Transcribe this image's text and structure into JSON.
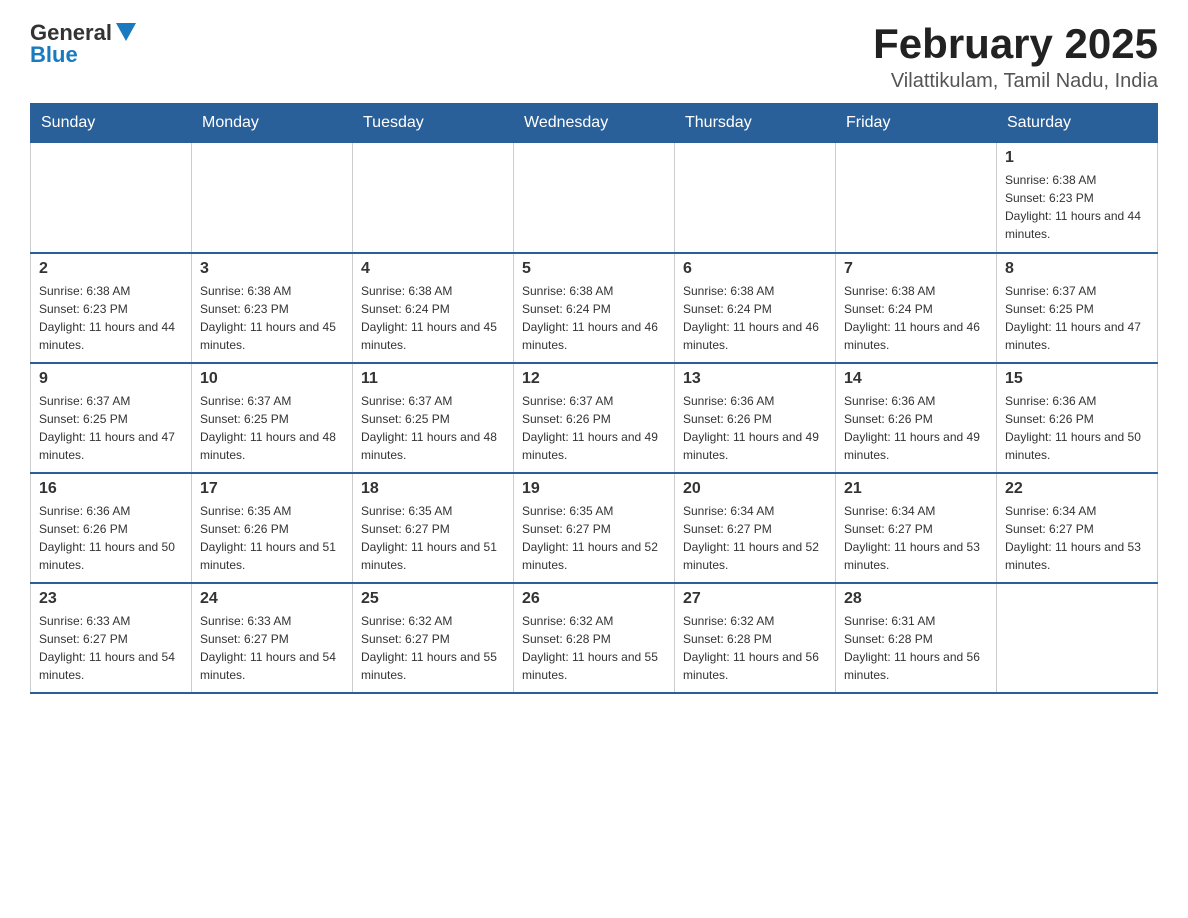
{
  "logo": {
    "text_general": "General",
    "text_blue": "Blue"
  },
  "title": "February 2025",
  "subtitle": "Vilattikulam, Tamil Nadu, India",
  "days_of_week": [
    "Sunday",
    "Monday",
    "Tuesday",
    "Wednesday",
    "Thursday",
    "Friday",
    "Saturday"
  ],
  "weeks": [
    [
      {
        "day": "",
        "info": ""
      },
      {
        "day": "",
        "info": ""
      },
      {
        "day": "",
        "info": ""
      },
      {
        "day": "",
        "info": ""
      },
      {
        "day": "",
        "info": ""
      },
      {
        "day": "",
        "info": ""
      },
      {
        "day": "1",
        "info": "Sunrise: 6:38 AM\nSunset: 6:23 PM\nDaylight: 11 hours and 44 minutes."
      }
    ],
    [
      {
        "day": "2",
        "info": "Sunrise: 6:38 AM\nSunset: 6:23 PM\nDaylight: 11 hours and 44 minutes."
      },
      {
        "day": "3",
        "info": "Sunrise: 6:38 AM\nSunset: 6:23 PM\nDaylight: 11 hours and 45 minutes."
      },
      {
        "day": "4",
        "info": "Sunrise: 6:38 AM\nSunset: 6:24 PM\nDaylight: 11 hours and 45 minutes."
      },
      {
        "day": "5",
        "info": "Sunrise: 6:38 AM\nSunset: 6:24 PM\nDaylight: 11 hours and 46 minutes."
      },
      {
        "day": "6",
        "info": "Sunrise: 6:38 AM\nSunset: 6:24 PM\nDaylight: 11 hours and 46 minutes."
      },
      {
        "day": "7",
        "info": "Sunrise: 6:38 AM\nSunset: 6:24 PM\nDaylight: 11 hours and 46 minutes."
      },
      {
        "day": "8",
        "info": "Sunrise: 6:37 AM\nSunset: 6:25 PM\nDaylight: 11 hours and 47 minutes."
      }
    ],
    [
      {
        "day": "9",
        "info": "Sunrise: 6:37 AM\nSunset: 6:25 PM\nDaylight: 11 hours and 47 minutes."
      },
      {
        "day": "10",
        "info": "Sunrise: 6:37 AM\nSunset: 6:25 PM\nDaylight: 11 hours and 48 minutes."
      },
      {
        "day": "11",
        "info": "Sunrise: 6:37 AM\nSunset: 6:25 PM\nDaylight: 11 hours and 48 minutes."
      },
      {
        "day": "12",
        "info": "Sunrise: 6:37 AM\nSunset: 6:26 PM\nDaylight: 11 hours and 49 minutes."
      },
      {
        "day": "13",
        "info": "Sunrise: 6:36 AM\nSunset: 6:26 PM\nDaylight: 11 hours and 49 minutes."
      },
      {
        "day": "14",
        "info": "Sunrise: 6:36 AM\nSunset: 6:26 PM\nDaylight: 11 hours and 49 minutes."
      },
      {
        "day": "15",
        "info": "Sunrise: 6:36 AM\nSunset: 6:26 PM\nDaylight: 11 hours and 50 minutes."
      }
    ],
    [
      {
        "day": "16",
        "info": "Sunrise: 6:36 AM\nSunset: 6:26 PM\nDaylight: 11 hours and 50 minutes."
      },
      {
        "day": "17",
        "info": "Sunrise: 6:35 AM\nSunset: 6:26 PM\nDaylight: 11 hours and 51 minutes."
      },
      {
        "day": "18",
        "info": "Sunrise: 6:35 AM\nSunset: 6:27 PM\nDaylight: 11 hours and 51 minutes."
      },
      {
        "day": "19",
        "info": "Sunrise: 6:35 AM\nSunset: 6:27 PM\nDaylight: 11 hours and 52 minutes."
      },
      {
        "day": "20",
        "info": "Sunrise: 6:34 AM\nSunset: 6:27 PM\nDaylight: 11 hours and 52 minutes."
      },
      {
        "day": "21",
        "info": "Sunrise: 6:34 AM\nSunset: 6:27 PM\nDaylight: 11 hours and 53 minutes."
      },
      {
        "day": "22",
        "info": "Sunrise: 6:34 AM\nSunset: 6:27 PM\nDaylight: 11 hours and 53 minutes."
      }
    ],
    [
      {
        "day": "23",
        "info": "Sunrise: 6:33 AM\nSunset: 6:27 PM\nDaylight: 11 hours and 54 minutes."
      },
      {
        "day": "24",
        "info": "Sunrise: 6:33 AM\nSunset: 6:27 PM\nDaylight: 11 hours and 54 minutes."
      },
      {
        "day": "25",
        "info": "Sunrise: 6:32 AM\nSunset: 6:27 PM\nDaylight: 11 hours and 55 minutes."
      },
      {
        "day": "26",
        "info": "Sunrise: 6:32 AM\nSunset: 6:28 PM\nDaylight: 11 hours and 55 minutes."
      },
      {
        "day": "27",
        "info": "Sunrise: 6:32 AM\nSunset: 6:28 PM\nDaylight: 11 hours and 56 minutes."
      },
      {
        "day": "28",
        "info": "Sunrise: 6:31 AM\nSunset: 6:28 PM\nDaylight: 11 hours and 56 minutes."
      },
      {
        "day": "",
        "info": ""
      }
    ]
  ]
}
